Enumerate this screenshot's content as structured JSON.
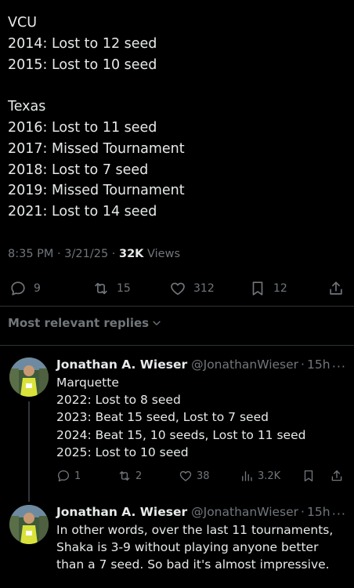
{
  "tweet": {
    "lines": [
      "VCU",
      "2014: Lost to 12 seed",
      "2015: Lost to 10 seed",
      "",
      "Texas",
      "2016: Lost to 11 seed",
      "2017: Missed Tournament",
      "2018: Lost to 7 seed",
      "2019: Missed Tournament",
      "2021: Lost to 14 seed"
    ],
    "time": "8:35 PM",
    "date": "3/21/25",
    "views_count": "32K",
    "views_label": "Views",
    "replies": "9",
    "reposts": "15",
    "likes": "312",
    "bookmarks": "12"
  },
  "sort_label": "Most relevant replies",
  "replies": [
    {
      "name": "Jonathan A. Wieser",
      "handle": "@JonathanWieser",
      "time": "15h",
      "lines": [
        "Marquette",
        "2022: Lost to 8 seed",
        "2023: Beat 15 seed, Lost to 7 seed",
        "2024: Beat 15, 10 seeds, Lost to 11 seed",
        "2025: Lost to 10 seed"
      ],
      "replies": "1",
      "reposts": "2",
      "likes": "38",
      "views": "3.2K"
    },
    {
      "name": "Jonathan A. Wieser",
      "handle": "@JonathanWieser",
      "time": "15h",
      "lines": [
        "In other words, over the last 11 tournaments,",
        "Shaka is 3-9 without playing anyone better",
        "than a 7 seed. So bad it's almost impressive."
      ]
    }
  ],
  "colors": {
    "background": "#000000",
    "text": "#e7e9ea",
    "muted": "#71767b",
    "divider": "#2f3336"
  }
}
